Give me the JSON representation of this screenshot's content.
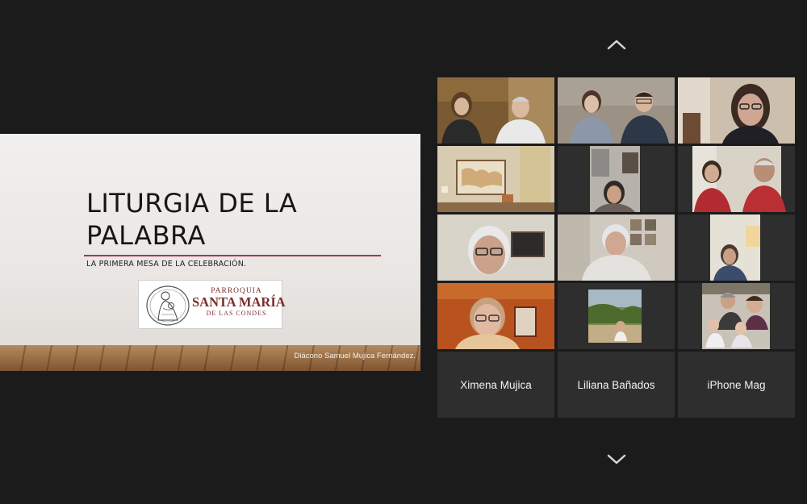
{
  "slide": {
    "title_line1": "LITURGIA DE LA",
    "title_line2": "PALABRA",
    "subtitle": "LA PRIMERA MESA DE LA CELEBRACIÓN.",
    "logo": {
      "line1": "PARROQUIA",
      "line2": "SANTA MARÍA",
      "line3": "DE LAS CONDES"
    },
    "credit": "Diácono Samuel Mujica Fernández."
  },
  "gallery": {
    "scroll_up_icon": "chevron-up-icon",
    "scroll_down_icon": "chevron-down-icon",
    "participants_without_video": [
      {
        "name": "Ximena Mujica"
      },
      {
        "name": "Liliana Bañados"
      },
      {
        "name": "iPhone Mag"
      }
    ]
  },
  "colors": {
    "background": "#1b1b1b",
    "tile": "#2e2e2e",
    "slide_accent": "#9c3b4b",
    "logo_text": "#7a2e2a"
  }
}
